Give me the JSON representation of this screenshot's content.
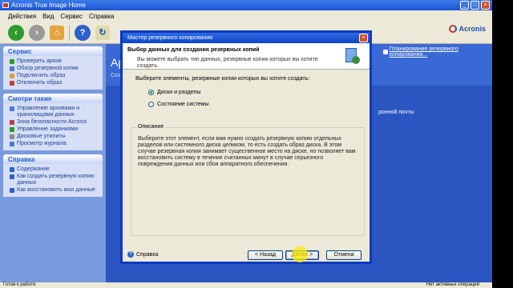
{
  "window": {
    "title": "Acronis True Image Home"
  },
  "menu": [
    "Действия",
    "Вид",
    "Сервис",
    "Справка"
  ],
  "brand": {
    "logo_text": "Acronis"
  },
  "sidebar": {
    "panels": [
      {
        "title": "Сервис",
        "items": [
          "Проверить архив",
          "Обзор резервной копии",
          "Подключить образ",
          "Отключить образ"
        ]
      },
      {
        "title": "Смотри также",
        "items": [
          "Управление архивами и хранилищами данных",
          "Зона безопасности Acronis",
          "Управление заданиями",
          "Дисковые утилиты",
          "Просмотр журнала"
        ]
      },
      {
        "title": "Справка",
        "items": [
          "Содержание",
          "Как создать резервную копию данных",
          "Как восстановить мои данные"
        ]
      }
    ]
  },
  "main": {
    "title_fragment": "Ар",
    "sub_fragment": "Соз",
    "schedule_link": "Планирование резервного копирования...",
    "email_fragment": "ронной почты"
  },
  "dialog": {
    "title": "Мастер резервного копирования",
    "header_title": "Выбор данных для создания резервных копий",
    "header_desc": "Вы можете выбрать тип данных, резервные копии которых вы хотите создать.",
    "prompt": "Выберите элементы, резервные копии которых вы хотите создать:",
    "options": [
      {
        "label": "Диски и разделы",
        "selected": true
      },
      {
        "label": "Состояние системы",
        "selected": false
      }
    ],
    "description_label": "Описание",
    "description_text": "Выберите этот элемент, если вам нужно создать резервную копию отдельных разделов или системного диска целиком, то есть создать образ диска. В этом случае резервная копия занимает существенное место на диске, но позволяет вам восстановить систему в течение считанных минут в случае серьезного повреждения данных или сбоя аппаратного обеспечения.",
    "help_label": "Справка",
    "back_label": "< Назад",
    "next_label": "Далее >",
    "cancel_label": "Отмена"
  },
  "status": {
    "left": "Готов к работе",
    "right": "Нет активных операций"
  }
}
